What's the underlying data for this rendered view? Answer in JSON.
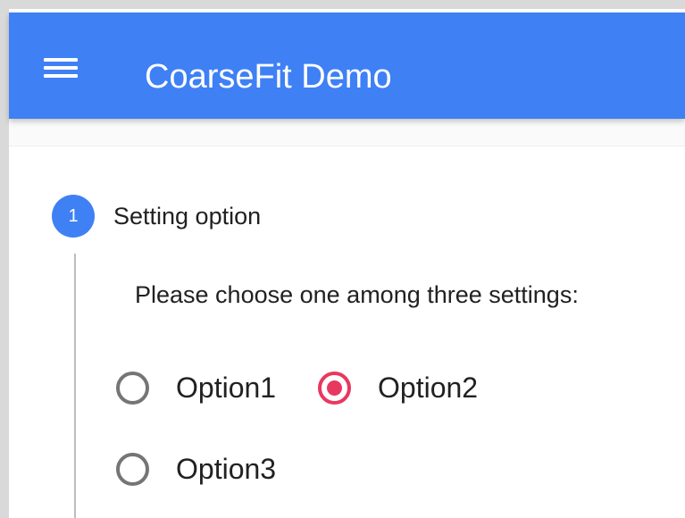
{
  "app_bar": {
    "title": "CoarseFit Demo",
    "menu_icon": "hamburger-menu-icon",
    "color": "#3f80f5"
  },
  "stepper": {
    "step_number": "1",
    "step_label": "Setting option",
    "step_color": "#3f80f5",
    "instruction": "Please choose one among three settings:"
  },
  "settings": {
    "selected": "Option2",
    "accent_color": "#e8385f",
    "options": [
      {
        "label": "Option1",
        "checked": false
      },
      {
        "label": "Option2",
        "checked": true
      },
      {
        "label": "Option3",
        "checked": false
      }
    ]
  }
}
